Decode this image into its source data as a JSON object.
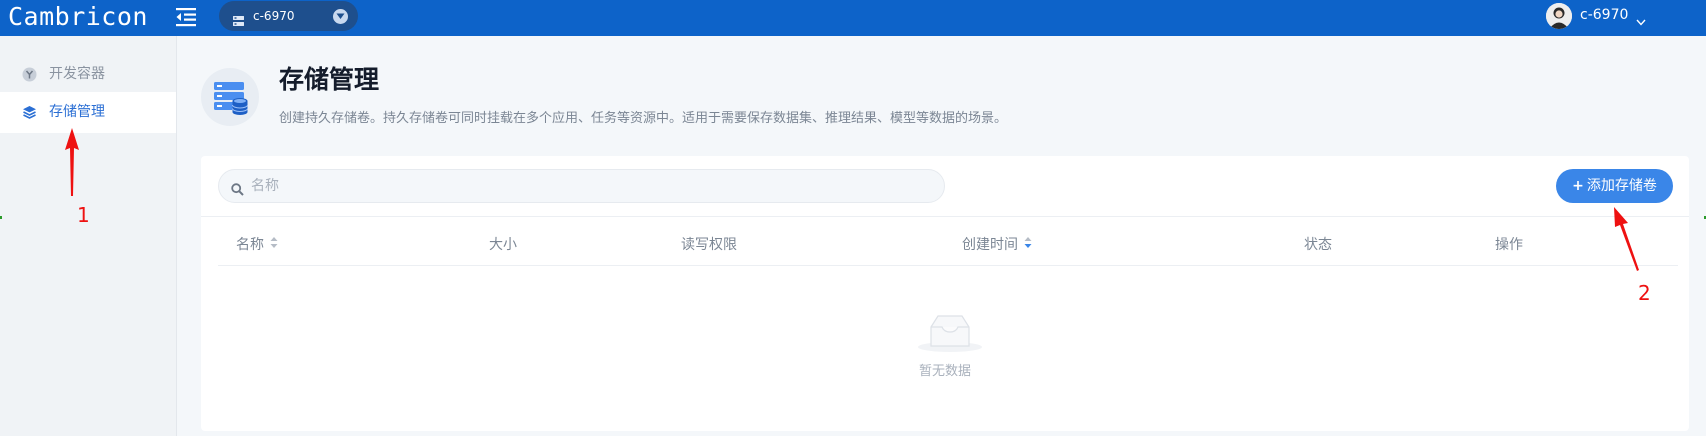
{
  "header": {
    "logo": "Cambricon",
    "environment": {
      "label": "c-6970"
    },
    "user": {
      "name": "c-6970"
    }
  },
  "sidebar": {
    "items": [
      {
        "label": "开发容器",
        "icon": "container-icon",
        "active": false
      },
      {
        "label": "存储管理",
        "icon": "storage-stack-icon",
        "active": true
      }
    ]
  },
  "page": {
    "title": "存储管理",
    "description": "创建持久存储卷。持久存储卷可同时挂载在多个应用、任务等资源中。适用于需要保存数据集、推理结果、模型等数据的场景。"
  },
  "toolbar": {
    "search_placeholder": "名称",
    "add_button_label": "添加存储卷"
  },
  "table": {
    "columns": [
      {
        "label": "名称",
        "sortable": true
      },
      {
        "label": "大小",
        "sortable": false
      },
      {
        "label": "读写权限",
        "sortable": false
      },
      {
        "label": "创建时间",
        "sortable": true,
        "sorted": true
      },
      {
        "label": "状态",
        "sortable": false
      },
      {
        "label": "操作",
        "sortable": false
      }
    ],
    "rows": [],
    "empty_text": "暂无数据"
  },
  "annotations": [
    {
      "label": "1",
      "color": "#ee1111"
    },
    {
      "label": "2",
      "color": "#ee1111"
    }
  ],
  "colors": {
    "topbar": "#0d63c9",
    "accent": "#3a86e8",
    "active_nav_text": "#2b6fd4"
  }
}
